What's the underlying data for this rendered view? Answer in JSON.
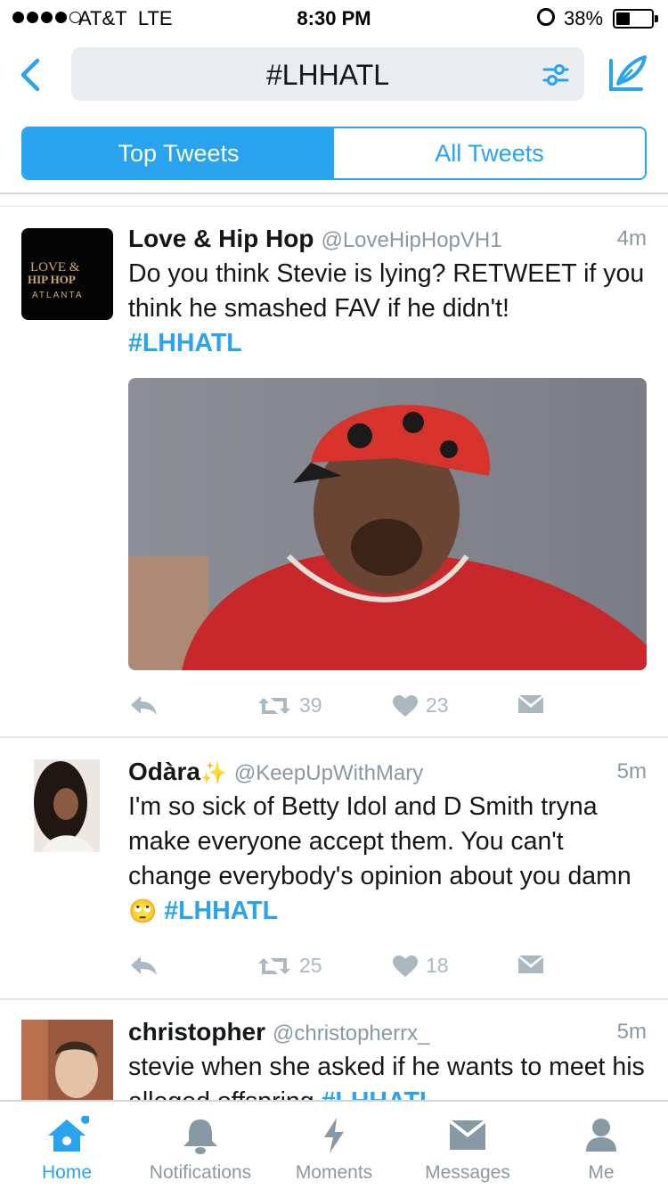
{
  "status_bar": {
    "carrier": "AT&T",
    "network": "LTE",
    "time": "8:30 PM",
    "battery": "38%",
    "battery_level": 0.38
  },
  "header": {
    "search_query": "#LHHATL"
  },
  "tabs": {
    "top": "Top Tweets",
    "all": "All Tweets",
    "selected": "Top Tweets"
  },
  "tweets": [
    {
      "name": "Love & Hip Hop",
      "handle": "@LoveHipHopVH1",
      "time": "4m",
      "avatar_text": {
        "line1": "LOVE &",
        "line2": "HIP HOP",
        "line3": "ATLANTA"
      },
      "text": "Do you think Stevie is lying? RETWEET if you think he smashed FAV if he didn't!",
      "hashtag": "#LHHATL",
      "retweets": "39",
      "likes": "23"
    },
    {
      "name": "Odàra",
      "emoji_after_name": "✨",
      "handle": "@KeepUpWithMary",
      "time": "5m",
      "text": "I'm so sick of Betty Idol and D Smith tryna make everyone accept them. You can't change everybody's opinion about you damn",
      "emoji": "🙄",
      "hashtag": "#LHHATL",
      "retweets": "25",
      "likes": "18"
    },
    {
      "name": "christopher",
      "handle": "@christopherrx_",
      "time": "5m",
      "text": "stevie when she asked if he wants to meet his alleged offspring",
      "hashtag": "#LHHATL"
    }
  ],
  "tab_bar": [
    {
      "label": "Home",
      "icon": "home-icon",
      "active": true
    },
    {
      "label": "Notifications",
      "icon": "bell-icon",
      "active": false
    },
    {
      "label": "Moments",
      "icon": "lightning-icon",
      "active": false
    },
    {
      "label": "Messages",
      "icon": "envelope-icon",
      "active": false
    },
    {
      "label": "Me",
      "icon": "person-icon",
      "active": false
    }
  ],
  "colors": {
    "accent": "#2aa3ef",
    "secondary_text": "#8899a6",
    "action_icons": "#aab8c2"
  }
}
